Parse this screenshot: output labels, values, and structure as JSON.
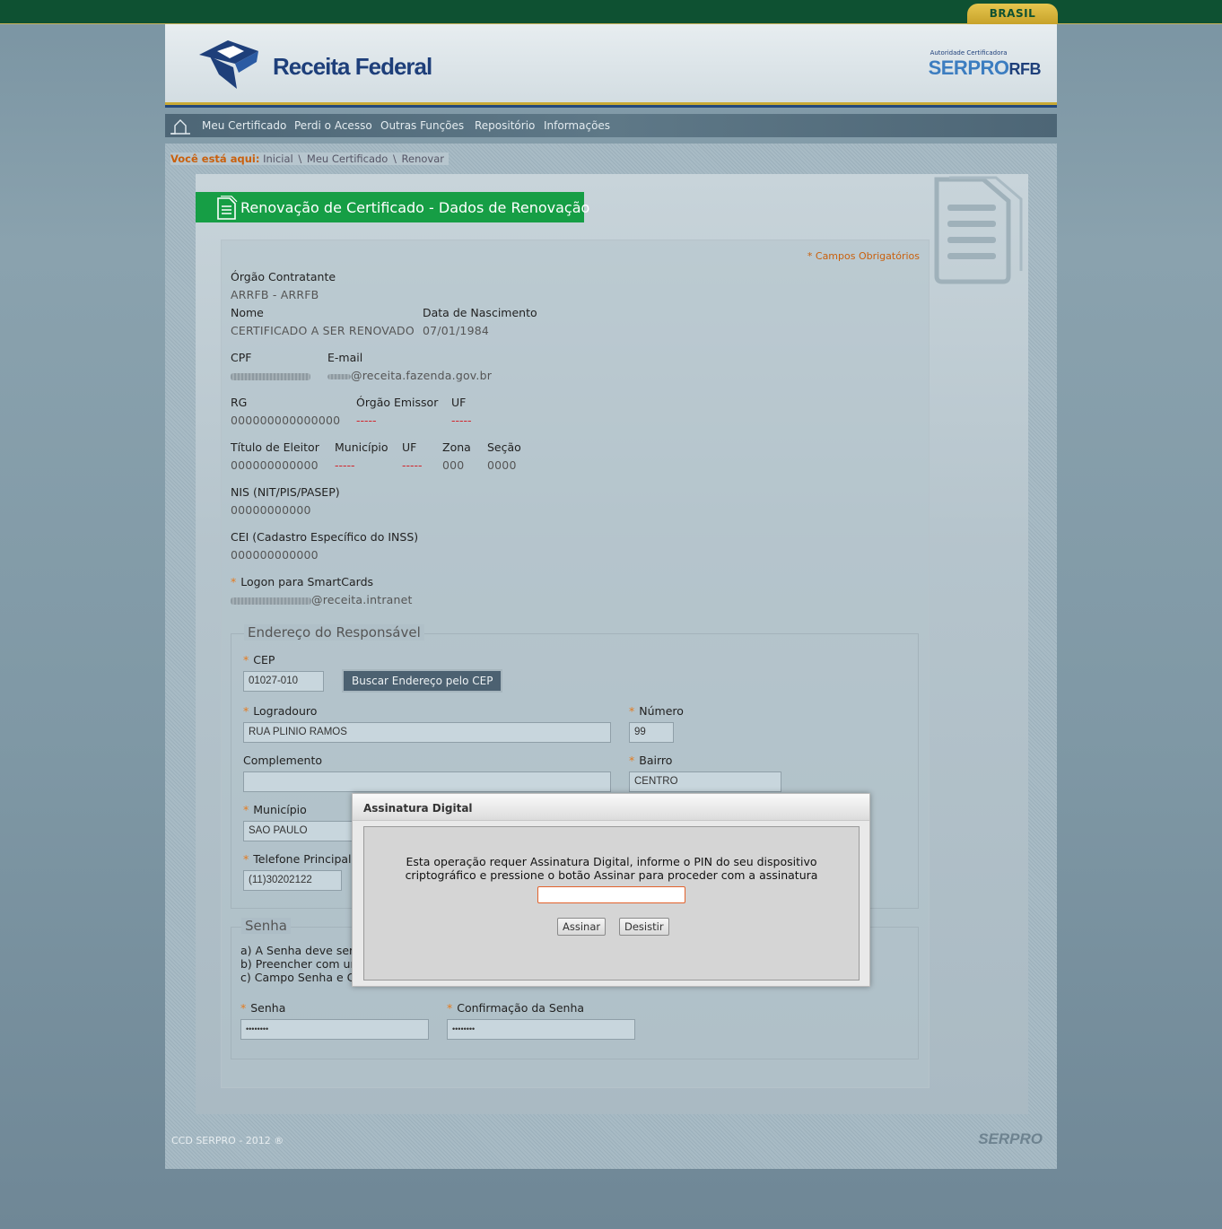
{
  "gov_bar": {
    "brasil_label": "BRASIL"
  },
  "header": {
    "logo_text": "Receita Federal",
    "serpro_small": "Autoridade Certificadora",
    "serpro_main": "SERPRO",
    "serpro_rfb": "RFB"
  },
  "nav": {
    "items": [
      "Meu Certificado",
      "Perdi o Acesso",
      "Outras Funções",
      "Repositório",
      "Informações"
    ]
  },
  "breadcrumb": {
    "label": "Você está aqui:",
    "crumbs": [
      "Inicial",
      "Meu Certificado",
      "Renovar"
    ]
  },
  "page_title": "Renovação de Certificado - Dados de Renovação",
  "required_note": "* Campos Obrigatórios",
  "fields": {
    "orgao_label": "Órgão Contratante",
    "orgao_value": "ARRFB - ARRFB",
    "nome_label": "Nome",
    "nome_value": "CERTIFICADO A SER RENOVADO",
    "nascimento_label": "Data de Nascimento",
    "nascimento_value": "07/01/1984",
    "cpf_label": "CPF",
    "email_label": "E-mail",
    "email_value": "@receita.fazenda.gov.br",
    "rg_label": "RG",
    "rg_value": "000000000000000",
    "orgao_emissor_label": "Órgão Emissor",
    "orgao_emissor_value": "-----",
    "uf_label": "UF",
    "uf_value": "-----",
    "titulo_label": "Título de Eleitor",
    "titulo_value": "000000000000",
    "municipio_label": "Município",
    "municipio_value": "-----",
    "uf2_label": "UF",
    "uf2_value": "-----",
    "zona_label": "Zona",
    "zona_value": "000",
    "secao_label": "Seção",
    "secao_value": "0000",
    "nis_label": "NIS (NIT/PIS/PASEP)",
    "nis_value": "00000000000",
    "cei_label": "CEI (Cadastro Específico do INSS)",
    "cei_value": "000000000000",
    "logon_label": "Logon para SmartCards",
    "logon_value": "@receita.intranet"
  },
  "endereco": {
    "legend": "Endereço do Responsável",
    "cep_label": "CEP",
    "cep_value": "01027-010",
    "buscar_button": "Buscar Endereço pelo CEP",
    "logradouro_label": "Logradouro",
    "logradouro_value": "RUA PLINIO RAMOS",
    "numero_label": "Número",
    "numero_value": "99",
    "complemento_label": "Complemento",
    "complemento_value": "",
    "bairro_label": "Bairro",
    "bairro_value": "CENTRO",
    "municipio_label": "Município",
    "municipio_value": "SAO PAULO",
    "telefone_label": "Telefone Principal",
    "telefone_value": "(11)30202122"
  },
  "senha": {
    "legend": "Senha",
    "hints": [
      "a) A Senha deve ser",
      "b) Preencher com ur",
      "c) Campo Senha e C"
    ],
    "senha_label": "Senha",
    "senha_value": "••••••••",
    "confirmacao_label": "Confirmação da Senha",
    "confirmacao_value": "••••••••"
  },
  "footer": {
    "copyright": "CCD SERPRO - 2012 ®",
    "logo": "SERPRO"
  },
  "modal": {
    "title": "Assinatura Digital",
    "message_line1": "Esta operação requer Assinatura Digital, informe o PIN do seu dispositivo",
    "message_line2": "criptográfico e pressione o botão Assinar para proceder com a assinatura",
    "pin_value": "",
    "sign_button": "Assinar",
    "cancel_button": "Desistir"
  },
  "colors": {
    "gov_green": "#0e5132",
    "title_green": "#169e45",
    "required_orange": "#e47a1e",
    "empty_red": "#d2232a",
    "brand_blue": "#1e3f7a"
  }
}
